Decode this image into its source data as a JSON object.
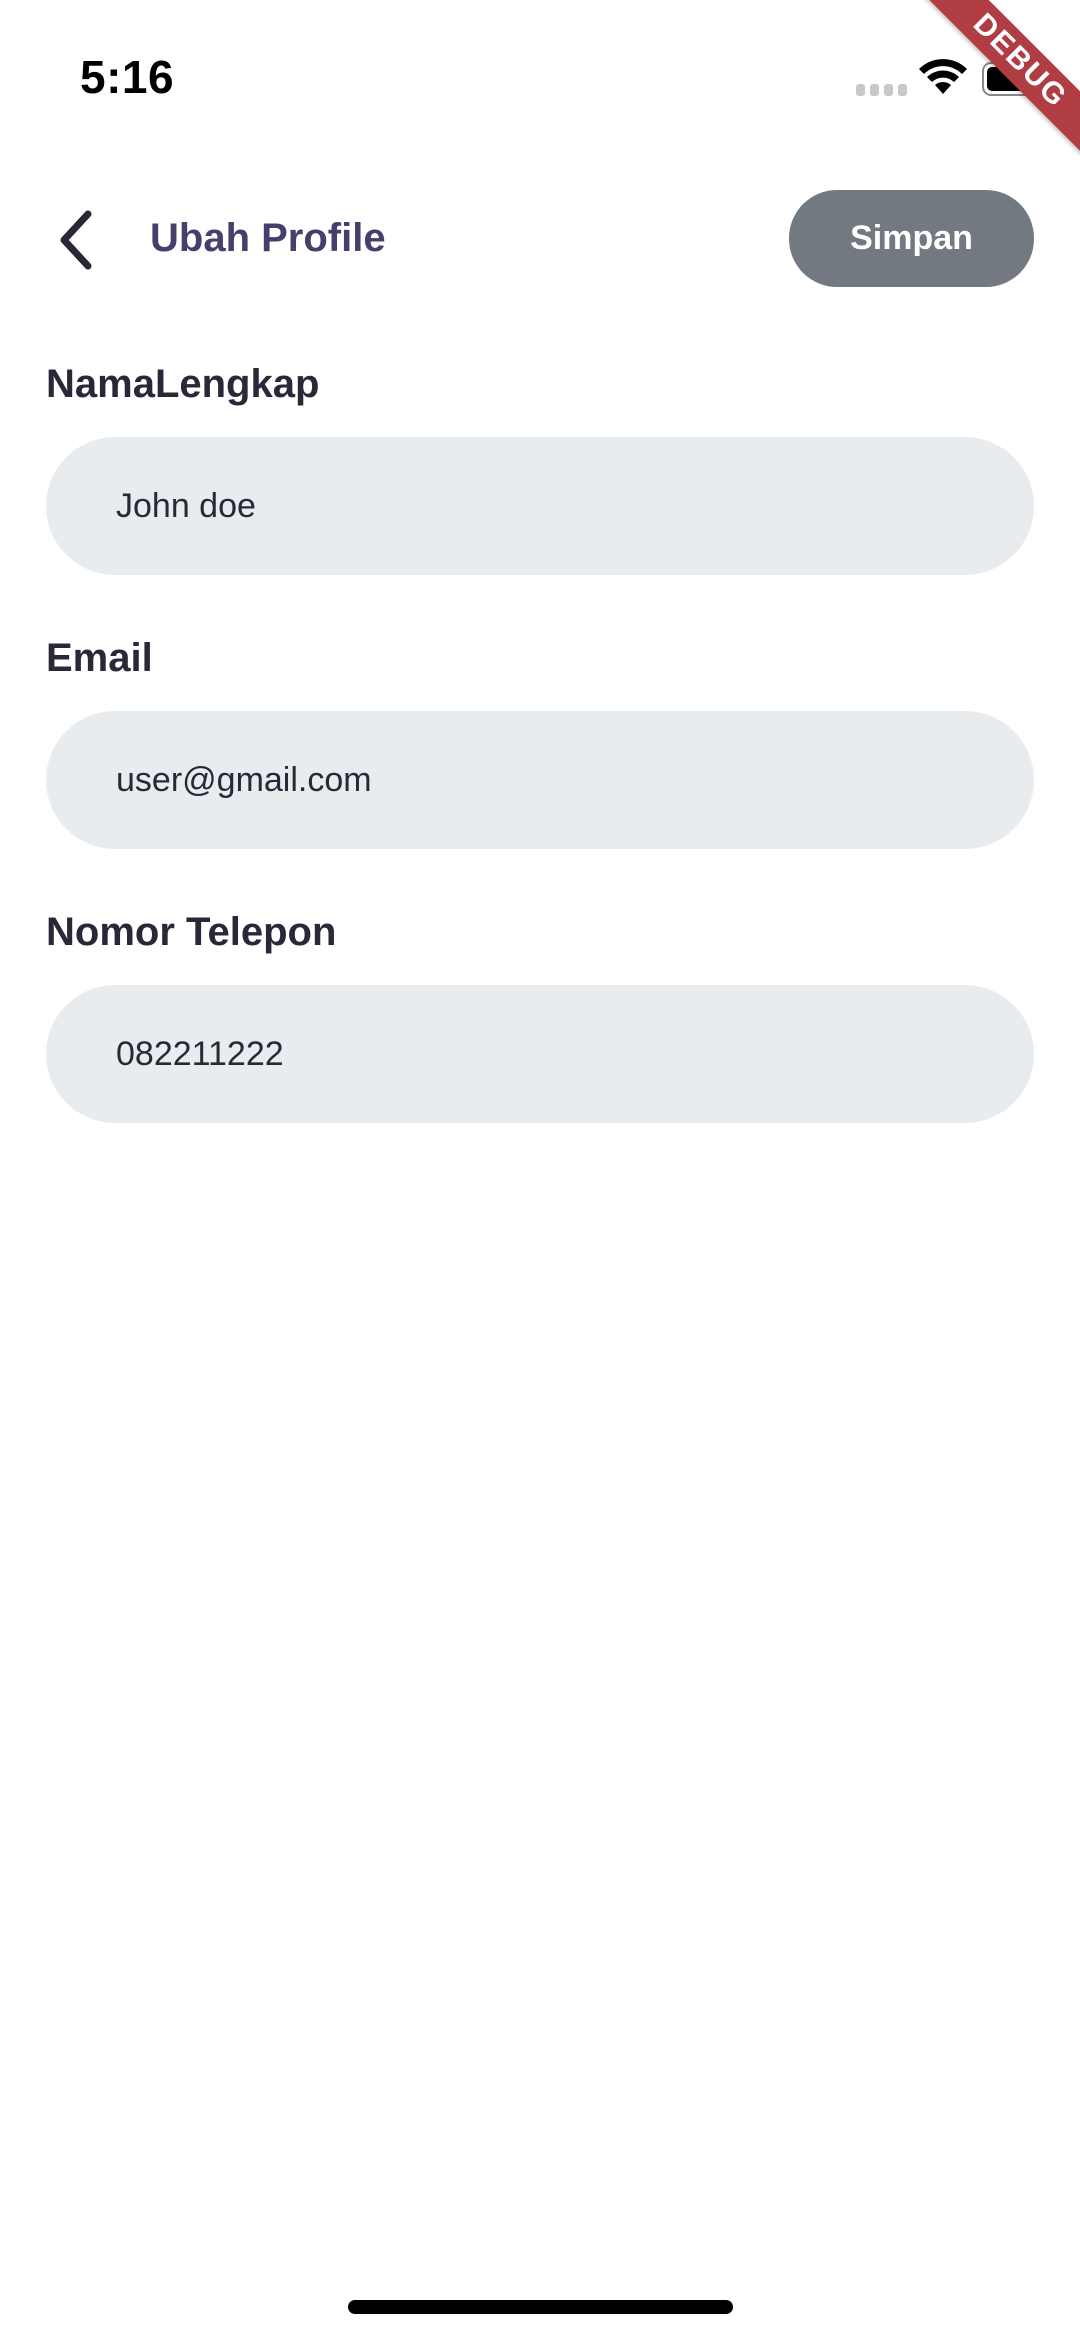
{
  "status_bar": {
    "time": "5:16",
    "icons": [
      "signal-icon",
      "wifi-icon",
      "battery-icon"
    ]
  },
  "debug_banner": {
    "label": "DEBUG"
  },
  "header": {
    "back_icon": "chevron-left-icon",
    "title": "Ubah Profile",
    "save_label": "Simpan"
  },
  "form": {
    "fields": [
      {
        "label": "NamaLengkap",
        "value": "John doe"
      },
      {
        "label": "Email",
        "value": "user@gmail.com"
      },
      {
        "label": "Nomor Telepon",
        "value": "082211222"
      }
    ]
  },
  "colors": {
    "title": "#453f6b",
    "label": "#2a2838",
    "field_bg": "#e9ecef",
    "save_button_bg": "#737980",
    "debug_ribbon": "#b13d44"
  }
}
